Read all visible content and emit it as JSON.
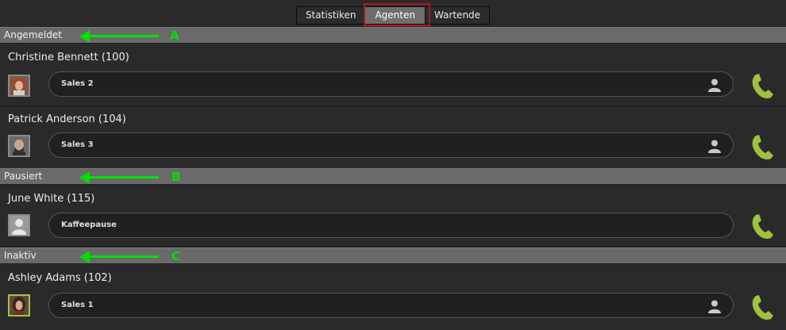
{
  "tabs": [
    {
      "label": "Statistiken",
      "active": false
    },
    {
      "label": "Agenten",
      "active": true
    },
    {
      "label": "Wartende",
      "active": false
    }
  ],
  "annotations": {
    "tab_marker": "2",
    "section_markers": [
      "A",
      "B",
      "C"
    ]
  },
  "sections": [
    {
      "label": "Angemeldet",
      "agents": [
        {
          "name": "Christine Bennett (100)",
          "status": "Sales 2",
          "avatar": "photo-woman-red-hair",
          "has_user_icon": true
        },
        {
          "name": "Patrick Anderson (104)",
          "status": "Sales 3",
          "avatar": "photo-man-beard",
          "has_user_icon": true
        }
      ]
    },
    {
      "label": "Pausiert",
      "agents": [
        {
          "name": "June White (115)",
          "status": "Kaffeepause",
          "avatar": "placeholder-user",
          "has_user_icon": false
        }
      ]
    },
    {
      "label": "Inaktiv",
      "agents": [
        {
          "name": "Ashley Adams (102)",
          "status": "Sales 1",
          "avatar": "photo-woman-dark-hair",
          "has_user_icon": true
        }
      ]
    }
  ],
  "colors": {
    "background": "#2a2a2a",
    "section_header": "#6a6a6a",
    "phone_icon": "#9fc23e",
    "annotation_green": "#00e000",
    "annotation_red": "#c8101c"
  },
  "icons": {
    "phone": "phone-handset-icon",
    "user": "user-silhouette-icon"
  }
}
